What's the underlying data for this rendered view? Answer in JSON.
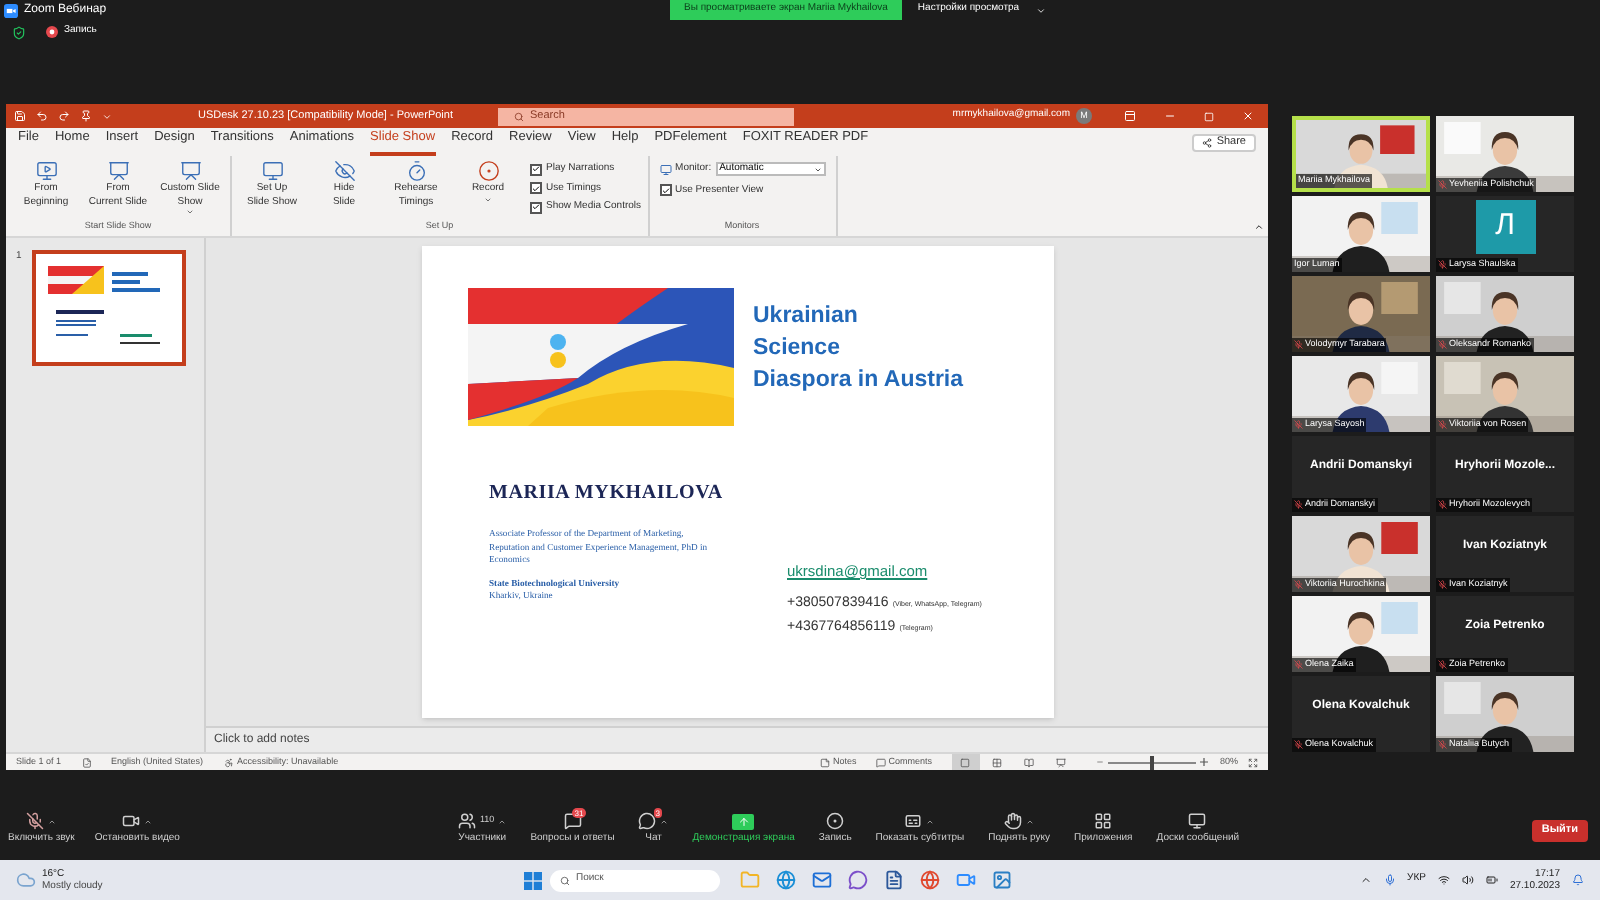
{
  "zoom_window": {
    "title": "Zoom Вебинар",
    "share_banner": "Вы просматриваете экран Mariia Mykhailova",
    "view_options": "Настройки просмотра",
    "recording": "Запись"
  },
  "powerpoint": {
    "title": "USDesk 27.10.23 [Compatibility Mode] - PowerPoint",
    "search": {
      "placeholder": "Search"
    },
    "account": "mrmykhailova@gmail.com",
    "avatar": "M",
    "tabs": [
      {
        "label": "File",
        "selected": false
      },
      {
        "label": "Home",
        "selected": false
      },
      {
        "label": "Insert",
        "selected": false
      },
      {
        "label": "Design",
        "selected": false
      },
      {
        "label": "Transitions",
        "selected": false
      },
      {
        "label": "Animations",
        "selected": false
      },
      {
        "label": "Slide Show",
        "selected": true
      },
      {
        "label": "Record",
        "selected": false
      },
      {
        "label": "Review",
        "selected": false
      },
      {
        "label": "View",
        "selected": false
      },
      {
        "label": "Help",
        "selected": false
      },
      {
        "label": "PDFelement",
        "selected": false
      },
      {
        "label": "FOXIT READER PDF",
        "selected": false
      }
    ],
    "share": "Share",
    "ribbon_groups": [
      {
        "label": "Start Slide Show",
        "buttons": [
          {
            "kind": "play",
            "lines": [
              "From",
              "Beginning"
            ],
            "menu": false
          },
          {
            "kind": "current",
            "lines": [
              "From",
              "Current Slide"
            ],
            "menu": false
          },
          {
            "kind": "custom",
            "lines": [
              "Custom Slide",
              "Show"
            ],
            "menu": true
          }
        ]
      },
      {
        "label": "Set Up",
        "buttons": [
          {
            "kind": "setup",
            "lines": [
              "Set Up",
              "Slide Show"
            ],
            "menu": false
          },
          {
            "kind": "hide",
            "lines": [
              "Hide",
              "Slide"
            ],
            "menu": false
          },
          {
            "kind": "rehearse",
            "lines": [
              "Rehearse",
              "Timings"
            ],
            "menu": false
          },
          {
            "kind": "record",
            "lines": [
              "Record"
            ],
            "menu": true
          }
        ],
        "checkboxes": [
          {
            "label": "Play Narrations",
            "checked": true
          },
          {
            "label": "Use Timings",
            "checked": true
          },
          {
            "label": "Show Media Controls",
            "checked": true
          }
        ]
      }
    ],
    "monitors": {
      "label": "Monitors",
      "monitor_label": "Monitor:",
      "monitor_value": "Automatic",
      "presenter_view": {
        "label": "Use Presenter View",
        "checked": true
      }
    },
    "slides": [
      {
        "number": "1",
        "selected": true
      }
    ],
    "slide": {
      "title_lines": [
        "Ukrainian",
        "Science",
        "Diaspora in Austria"
      ],
      "author": "MARIIA MYKHAILOVA",
      "position": "Associate Professor of the Department of Marketing, Reputation and Customer Experience Management, PhD in Economics",
      "university": "State Biotechnological University",
      "city": "Kharkiv, Ukraine",
      "email": "ukrsdina@gmail.com",
      "phones": [
        {
          "number": "+380507839416",
          "note": "(Viber, WhatsApp, Telegram)"
        },
        {
          "number": "+4367764856119",
          "note": "(Telegram)"
        }
      ]
    },
    "notes": {
      "placeholder": "Click to add notes"
    },
    "status_bar": {
      "slide": "Slide 1 of 1",
      "language": "English (United States)",
      "accessibility": "Accessibility: Unavailable",
      "notes": "Notes",
      "comments": "Comments",
      "views": [
        {
          "kind": "normal",
          "selected": true
        },
        {
          "kind": "sorter",
          "selected": false
        },
        {
          "kind": "reading",
          "selected": false
        },
        {
          "kind": "slideshow",
          "selected": false
        }
      ],
      "zoom": {
        "level": 0.5,
        "reading": "80%"
      }
    }
  },
  "participants": [
    {
      "name": "Mariia Mykhailova",
      "kind": "video",
      "muted": false,
      "active": true
    },
    {
      "name": "Yevheniia Polishchuk",
      "kind": "video",
      "muted": true,
      "active": false
    },
    {
      "name": "Igor Luman",
      "kind": "video",
      "muted": false,
      "active": false
    },
    {
      "name": "Larysa Shaulska",
      "kind": "avatar",
      "initial": "Л",
      "muted": true,
      "active": false
    },
    {
      "name": "Volodymyr Tarabara",
      "kind": "video",
      "muted": true,
      "active": false
    },
    {
      "name": "Oleksandr Romanko",
      "kind": "video",
      "muted": true,
      "active": false
    },
    {
      "name": "Larysa Sayosh",
      "kind": "video",
      "muted": true,
      "active": false
    },
    {
      "name": "Viktoriia von Rosen",
      "kind": "video",
      "muted": true,
      "active": false
    },
    {
      "name": "Andrii Domanskyi",
      "kind": "name",
      "display_name": "Andrii Domanskyi",
      "muted": true,
      "active": false
    },
    {
      "name": "Hryhorii Mozolevych",
      "kind": "name",
      "display_name": "Hryhorii  Mozole...",
      "muted": true,
      "active": false
    },
    {
      "name": "Viktoriia Hurochkina",
      "kind": "video",
      "muted": true,
      "active": false
    },
    {
      "name": "Ivan Koziatnyk",
      "kind": "name",
      "display_name": "Ivan Koziatnyk",
      "muted": true,
      "active": false
    },
    {
      "name": "Olena Zaika",
      "kind": "video",
      "muted": true,
      "active": false
    },
    {
      "name": "Zoia Petrenko",
      "kind": "name",
      "display_name": "Zoia Petrenko",
      "muted": true,
      "active": false
    },
    {
      "name": "Olena Kovalchuk",
      "kind": "name",
      "display_name": "Olena Kovalchuk",
      "muted": true,
      "active": false
    },
    {
      "name": "Nataliia Butych",
      "kind": "video",
      "muted": true,
      "active": false
    }
  ],
  "toolbar": [
    {
      "label": "Включить звук",
      "kind": "mic",
      "menu": true
    },
    {
      "label": "Остановить видео",
      "kind": "video",
      "menu": true
    },
    {
      "label": "Участники",
      "kind": "people",
      "count": "110",
      "menu": true
    },
    {
      "label": "Вопросы и ответы",
      "kind": "qa",
      "badge": "31",
      "menu": false
    },
    {
      "label": "Чат",
      "kind": "chat",
      "badge": "3",
      "menu": true
    },
    {
      "label": "Демонстрация экрана",
      "kind": "share",
      "menu": false
    },
    {
      "label": "Запись",
      "kind": "record",
      "menu": false
    },
    {
      "label": "Показать субтитры",
      "kind": "cc",
      "menu": true
    },
    {
      "label": "Поднять руку",
      "kind": "hand",
      "menu": true
    },
    {
      "label": "Приложения",
      "kind": "apps",
      "menu": false
    },
    {
      "label": "Доски сообщений",
      "kind": "board",
      "menu": false
    }
  ],
  "leave": "Выйти",
  "taskbar": {
    "weather": {
      "temperature": "16°C",
      "condition": "Mostly cloudy"
    },
    "search": {
      "placeholder": "Поиск"
    },
    "apps": [
      {
        "kind": "files"
      },
      {
        "kind": "browser"
      },
      {
        "kind": "mail"
      },
      {
        "kind": "messenger"
      },
      {
        "kind": "document"
      },
      {
        "kind": "chrome"
      },
      {
        "kind": "zoom"
      },
      {
        "kind": "photos"
      }
    ],
    "language": "УКР",
    "time": "17:17",
    "date": "27.10.2023"
  }
}
